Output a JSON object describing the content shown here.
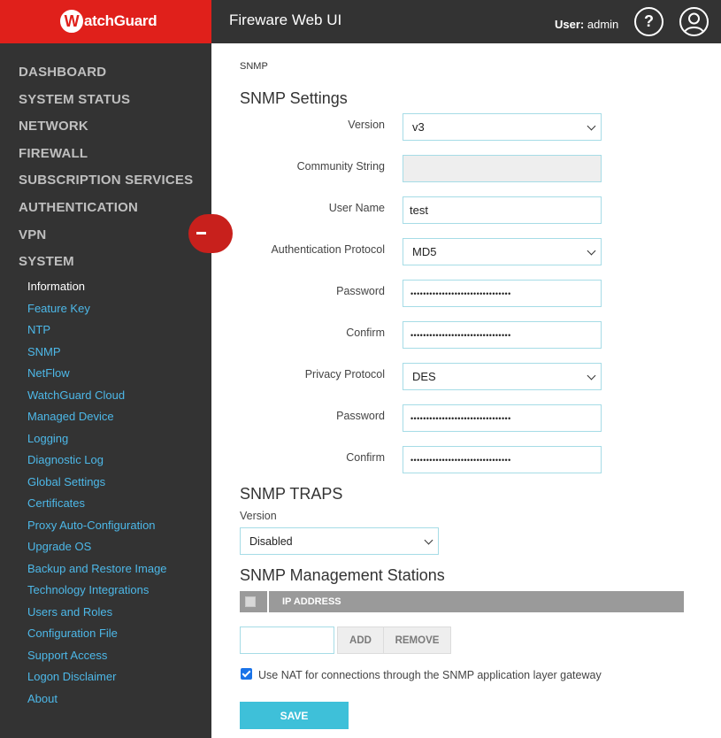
{
  "header": {
    "logo_text": "atchGuard",
    "logo_initial": "W",
    "app_title": "Fireware Web UI",
    "user_prefix": "User:",
    "user_name": "admin",
    "help_label": "?",
    "brand_color": "#e0201b",
    "icons": [
      "help-icon",
      "user-profile-icon"
    ]
  },
  "sidebar": {
    "main_items": [
      {
        "label": "DASHBOARD"
      },
      {
        "label": "SYSTEM STATUS"
      },
      {
        "label": "NETWORK"
      },
      {
        "label": "FIREWALL"
      },
      {
        "label": "SUBSCRIPTION SERVICES"
      },
      {
        "label": "AUTHENTICATION"
      },
      {
        "label": "VPN"
      },
      {
        "label": "SYSTEM"
      }
    ],
    "sub_items": [
      {
        "label": "Information",
        "active": true
      },
      {
        "label": "Feature Key"
      },
      {
        "label": "NTP"
      },
      {
        "label": "SNMP"
      },
      {
        "label": "NetFlow"
      },
      {
        "label": "WatchGuard Cloud"
      },
      {
        "label": "Managed Device"
      },
      {
        "label": "Logging"
      },
      {
        "label": "Diagnostic Log"
      },
      {
        "label": "Global Settings"
      },
      {
        "label": "Certificates"
      },
      {
        "label": "Proxy Auto-Configuration"
      },
      {
        "label": "Upgrade OS"
      },
      {
        "label": "Backup and Restore Image"
      },
      {
        "label": "Technology Integrations"
      },
      {
        "label": "Users and Roles"
      },
      {
        "label": "Configuration File"
      },
      {
        "label": "Support Access"
      },
      {
        "label": "Logon Disclaimer"
      },
      {
        "label": "About"
      }
    ],
    "collapse_icon": "minus-icon"
  },
  "main": {
    "breadcrumb": "SNMP",
    "settings_title": "SNMP Settings",
    "fields": {
      "version": {
        "label": "Version",
        "value": "v3"
      },
      "community": {
        "label": "Community String",
        "value": ""
      },
      "user_name": {
        "label": "User Name",
        "value": "test"
      },
      "auth_protocol": {
        "label": "Authentication Protocol",
        "value": "MD5"
      },
      "auth_password": {
        "label": "Password",
        "value": "••••••••••••••••••••••••••••••••"
      },
      "auth_confirm": {
        "label": "Confirm",
        "value": "••••••••••••••••••••••••••••••••"
      },
      "privacy_protocol": {
        "label": "Privacy Protocol",
        "value": "DES"
      },
      "privacy_password": {
        "label": "Password",
        "value": "••••••••••••••••••••••••••••••••"
      },
      "privacy_confirm": {
        "label": "Confirm",
        "value": "••••••••••••••••••••••••••••••••"
      }
    },
    "traps_title": "SNMP TRAPS",
    "traps_version_label": "Version",
    "traps_version_value": "Disabled",
    "stations_title": "SNMP Management Stations",
    "stations_column": "IP ADDRESS",
    "add_label": "ADD",
    "remove_label": "REMOVE",
    "nat_checked": true,
    "nat_label": "Use NAT for connections through the SNMP application layer gateway",
    "save_label": "SAVE",
    "accent_color": "#3ec0d9"
  }
}
